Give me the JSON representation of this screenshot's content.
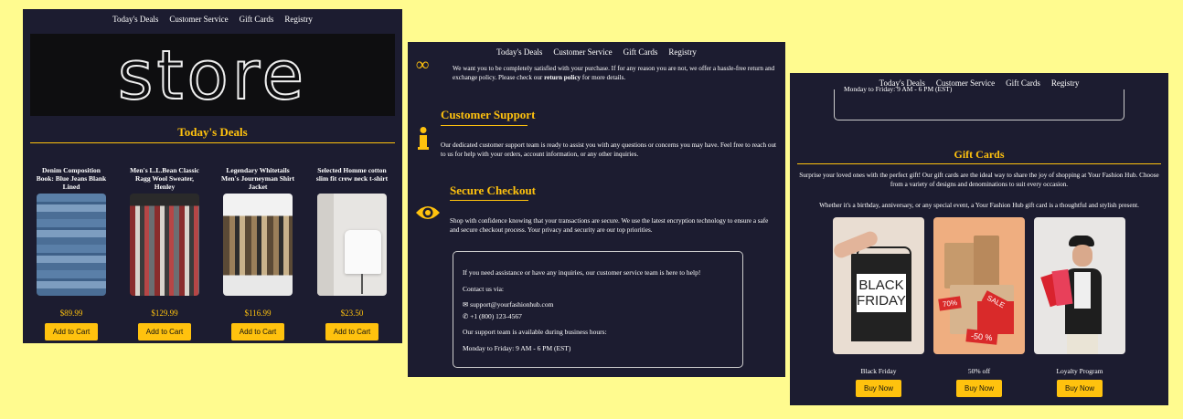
{
  "nav": [
    "Today's Deals",
    "Customer Service",
    "Gift Cards",
    "Registry"
  ],
  "panel1": {
    "hero_text": "store",
    "deals_heading": "Today's Deals",
    "products": [
      {
        "title": "Denim Composition Book: Blue Jeans Blank Lined",
        "price": "$89.99",
        "button": "Add to Cart"
      },
      {
        "title": "Men's L.L.Bean Classic Ragg Wool Sweater, Henley",
        "price": "$129.99",
        "button": "Add to Cart"
      },
      {
        "title": "Legendary Whitetails Men's Journeyman Shirt Jacket",
        "price": "$116.99",
        "button": "Add to Cart"
      },
      {
        "title": "Selected Homme cotton slim fit crew neck t-shirt",
        "price": "$23.50",
        "button": "Add to Cart"
      }
    ]
  },
  "panel2": {
    "return_text_1": "We want you to be completely satisfied with your purchase. If for any reason you are not, we offer a hassle-free return and exchange policy. Please check our ",
    "return_link": "return policy",
    "return_text_2": " for more details.",
    "support_heading": "Customer Support",
    "support_text": "Our dedicated customer support team is ready to assist you with any questions or concerns you may have. Feel free to reach out to us for help with your orders, account information, or any other inquiries.",
    "checkout_heading": "Secure Checkout",
    "checkout_text": "Shop with confidence knowing that your transactions are secure. We use the latest encryption technology to ensure a safe and secure checkout process. Your privacy and security are our top priorities.",
    "contact": {
      "intro": "If you need assistance or have any inquiries, our customer service team is here to help!",
      "via": "Contact us via:",
      "email": "support@yourfashionhub.com",
      "phone": "+1 (800) 123-4567",
      "hours_intro": "Our support team is available during business hours:",
      "hours": "Monday to Friday: 9 AM - 6 PM (EST)"
    }
  },
  "panel3": {
    "hours": "Monday to Friday: 9 AM - 6 PM (EST)",
    "gift_heading": "Gift Cards",
    "gift_text_1": "Surprise your loved ones with the perfect gift! Our gift cards are the ideal way to share the joy of shopping at Your Fashion Hub. Choose from a variety of designs and denominations to suit every occasion.",
    "gift_text_2": "Whether it's a birthday, anniversary, or any special event, a Your Fashion Hub gift card is a thoughtful and stylish present.",
    "cards": [
      {
        "caption": "Black Friday",
        "button": "Buy Now",
        "img_text_1": "BLACK",
        "img_text_2": "FRIDAY"
      },
      {
        "caption": "50% off",
        "button": "Buy Now",
        "img_tag_1": "70%",
        "img_tag_2": "SALE",
        "img_tag_3": "-50 %"
      },
      {
        "caption": "Loyalty Program",
        "button": "Buy Now"
      }
    ]
  },
  "colors": {
    "background": "#fffb8f",
    "panel": "#1c1c30",
    "accent": "#ffc20e"
  }
}
